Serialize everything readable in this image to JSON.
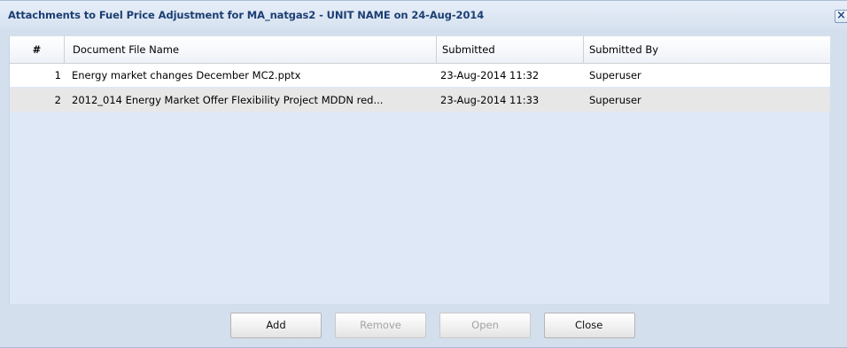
{
  "dialog": {
    "title": "Attachments to Fuel Price Adjustment for MA_natgas2 - UNIT NAME on 24-Aug-2014",
    "close_icon": "close-icon",
    "close_glyph": "×"
  },
  "table": {
    "columns": [
      "#",
      "Document File Name",
      "Submitted",
      "Submitted By"
    ],
    "rows": [
      {
        "num": "1",
        "file_name": "Energy market changes December MC2.pptx",
        "submitted": "23-Aug-2014 11:32",
        "submitted_by": "Superuser"
      },
      {
        "num": "2",
        "file_name": "2012_014 Energy Market Offer Flexibility Project MDDN red...",
        "submitted": "23-Aug-2014 11:33",
        "submitted_by": "Superuser"
      }
    ]
  },
  "buttons": {
    "add": "Add",
    "remove": "Remove",
    "open": "Open",
    "close": "Close"
  },
  "colors": {
    "title_text": "#1c3f73",
    "panel_background": "#d4dfed",
    "grid_background": "#dfe8f6",
    "selected_row": "#e7e7e7"
  }
}
